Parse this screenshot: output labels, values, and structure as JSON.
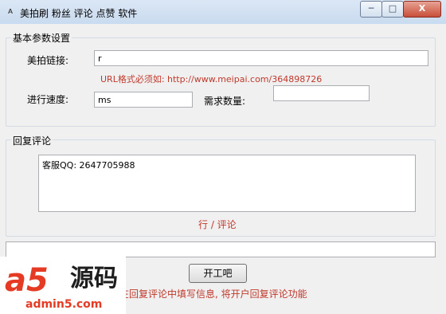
{
  "window": {
    "title": "美拍刷 粉丝 评论 点赞 软件",
    "app_icon": "ant-app-icon",
    "minimize": "─",
    "maximize": "□",
    "close": "X"
  },
  "basic_group": {
    "legend": "基本参数设置",
    "link_label": "美拍链接:",
    "link_value": "r",
    "url_hint": "URL格式必须如: http://www.meipai.com/364898726",
    "speed_label": "进行速度:",
    "speed_value": "ms",
    "qty_label": "需求数量:",
    "qty_value": ""
  },
  "reply_group": {
    "legend": "回复评论",
    "text": "客服QQ:  2647705988",
    "line_hint": "行 / 评论"
  },
  "status_field": "",
  "start_button": "开工吧",
  "footer_hint": "在回复评论中填写信息, 将开户回复评论功能",
  "watermark": {
    "logo": "a5",
    "text": "源码",
    "url": "admin5.com"
  },
  "colors": {
    "hint_red": "#c0392b",
    "titlebar": "#c9dbef",
    "close_red": "#c74f3b"
  }
}
